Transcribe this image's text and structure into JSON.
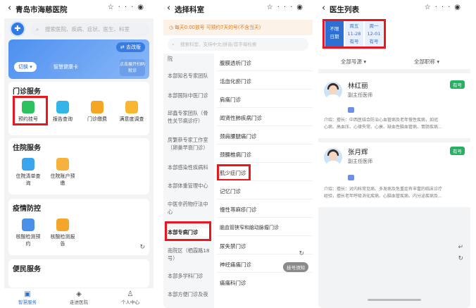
{
  "colors": {
    "accent": "#2d6fd3",
    "highlight": "#e8161d",
    "badge": "#27b063",
    "notice": "#e07a14"
  },
  "screen1": {
    "title": "青岛市海慈医院",
    "search_placeholder": "搜索医院、疾病、症状、医生、科室",
    "old_version": "去改版",
    "switch_label": "切换",
    "health_card": "智慧健康卡",
    "qr_hint": "点击展开扫码就诊",
    "outpatient": {
      "title": "门诊服务",
      "items": [
        "预约挂号",
        "报告查询",
        "门诊缴费",
        "满意度调查"
      ]
    },
    "inpatient": {
      "title": "住院服务",
      "items": [
        "住院清单查询",
        "住院账户预缴"
      ]
    },
    "epidemic": {
      "title": "疫情防控",
      "items": [
        "核酸检测预约",
        "核酸检测报告"
      ]
    },
    "convenience": {
      "title": "便民服务"
    },
    "tabs": [
      "智慧服务",
      "走进医院",
      "个人中心"
    ]
  },
  "screen2": {
    "title": "选择科室",
    "notice": "每天0:00放号 可预约7天的号(不含当天)",
    "search_placeholder": "搜索科室、支持中文/拼音/首字母检索",
    "left": [
      "院",
      "本部知名专家团队",
      "本部国际中医门诊",
      "邱鑫专家团队（骨性关节病诊疗）",
      "房繁恭专家工作室（卵巢早衰门诊）",
      "本部感染性疾病科",
      "本部体重管理中心",
      "中医非药物疗法中心",
      "本部专病门诊",
      "南院区（栖霞路18号）",
      "本部多学科门诊",
      "本部方便门诊及夜"
    ],
    "right": [
      "腹膜透析门诊",
      "活血化瘀门诊",
      "肩痛门诊",
      "闻贤性肺疾病门诊",
      "颈肩腰腿痛门诊",
      "颈腰椎病门诊",
      "肌少症门诊",
      "记忆门诊",
      "慢性荨麻疹门诊",
      "脑血管狭窄和脑动脉瘤门诊",
      "尿失禁门诊",
      "神经痛痛门诊",
      "痛痛科门诊"
    ],
    "reminder": "挂号须知"
  },
  "screen3": {
    "title": "医生列表",
    "dates": [
      {
        "l1": "不限",
        "l2": "日期"
      },
      {
        "l1": "周五",
        "l2": "11-28",
        "l3": "有号"
      },
      {
        "l1": "周一",
        "l2": "12-01",
        "l3": "有号"
      }
    ],
    "filters": [
      "全部号源",
      "全部职称"
    ],
    "doctors": [
      {
        "name": "林红丽",
        "title": "副主任医师",
        "badge": "有号",
        "intro": "介绍：擅长：中西医结合防治心血管病及老年慢性疾病，如冠",
        "intro2": "心病、高血压、心律失常、心衰、缺血性脑血管病、胃肠疾病..."
      },
      {
        "name": "张月辉",
        "title": "副主任医师",
        "badge": "有号",
        "intro": "介绍：擅长：对内科常见病、多发病及危重症有丰富的临床诊疗",
        "intro2": "经验，擅长老年呼吸消化疾病、心脑血管疾病、内分泌疾病及..."
      }
    ]
  }
}
